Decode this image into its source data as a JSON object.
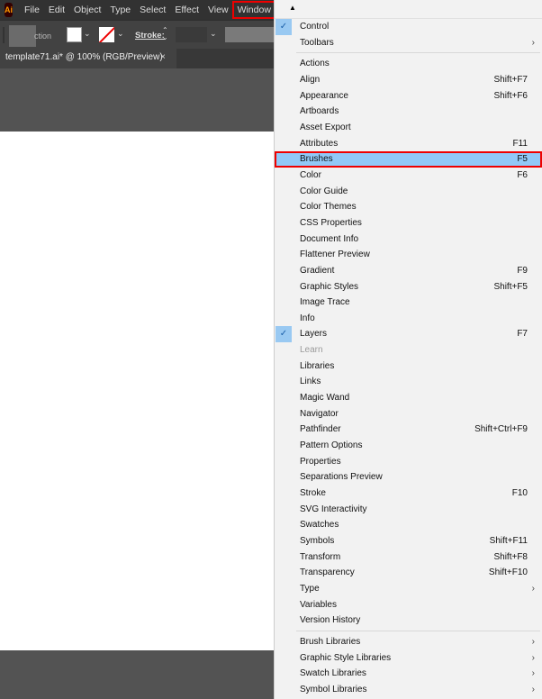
{
  "app": {
    "logo": "Ai"
  },
  "menubar": [
    "File",
    "Edit",
    "Object",
    "Type",
    "Select",
    "Effect",
    "View",
    "Window"
  ],
  "control": {
    "ghost_label": "ction",
    "stroke_label": "Stroke:"
  },
  "document_tab": {
    "title": "template71.ai* @ 100% (RGB/Preview)",
    "close": "×"
  },
  "menu": {
    "top": [
      {
        "label": "Control",
        "checked": true
      },
      {
        "label": "Toolbars",
        "submenu": true
      }
    ],
    "panels": [
      {
        "label": "Actions"
      },
      {
        "label": "Align",
        "shortcut": "Shift+F7"
      },
      {
        "label": "Appearance",
        "shortcut": "Shift+F6"
      },
      {
        "label": "Artboards"
      },
      {
        "label": "Asset Export"
      },
      {
        "label": "Attributes",
        "shortcut": "F11"
      },
      {
        "label": "Brushes",
        "shortcut": "F5",
        "highlighted": true
      },
      {
        "label": "Color",
        "shortcut": "F6"
      },
      {
        "label": "Color Guide"
      },
      {
        "label": "Color Themes"
      },
      {
        "label": "CSS Properties"
      },
      {
        "label": "Document Info"
      },
      {
        "label": "Flattener Preview"
      },
      {
        "label": "Gradient",
        "shortcut": "F9"
      },
      {
        "label": "Graphic Styles",
        "shortcut": "Shift+F5"
      },
      {
        "label": "Image Trace"
      },
      {
        "label": "Info"
      },
      {
        "label": "Layers",
        "shortcut": "F7",
        "checked": true
      },
      {
        "label": "Learn",
        "disabled": true
      },
      {
        "label": "Libraries"
      },
      {
        "label": "Links"
      },
      {
        "label": "Magic Wand"
      },
      {
        "label": "Navigator"
      },
      {
        "label": "Pathfinder",
        "shortcut": "Shift+Ctrl+F9"
      },
      {
        "label": "Pattern Options"
      },
      {
        "label": "Properties"
      },
      {
        "label": "Separations Preview"
      },
      {
        "label": "Stroke",
        "shortcut": "F10"
      },
      {
        "label": "SVG Interactivity"
      },
      {
        "label": "Swatches"
      },
      {
        "label": "Symbols",
        "shortcut": "Shift+F11"
      },
      {
        "label": "Transform",
        "shortcut": "Shift+F8"
      },
      {
        "label": "Transparency",
        "shortcut": "Shift+F10"
      },
      {
        "label": "Type",
        "submenu": true
      },
      {
        "label": "Variables"
      },
      {
        "label": "Version History"
      }
    ],
    "libraries": [
      {
        "label": "Brush Libraries",
        "submenu": true
      },
      {
        "label": "Graphic Style Libraries",
        "submenu": true
      },
      {
        "label": "Swatch Libraries",
        "submenu": true
      },
      {
        "label": "Symbol Libraries",
        "submenu": true
      }
    ]
  }
}
